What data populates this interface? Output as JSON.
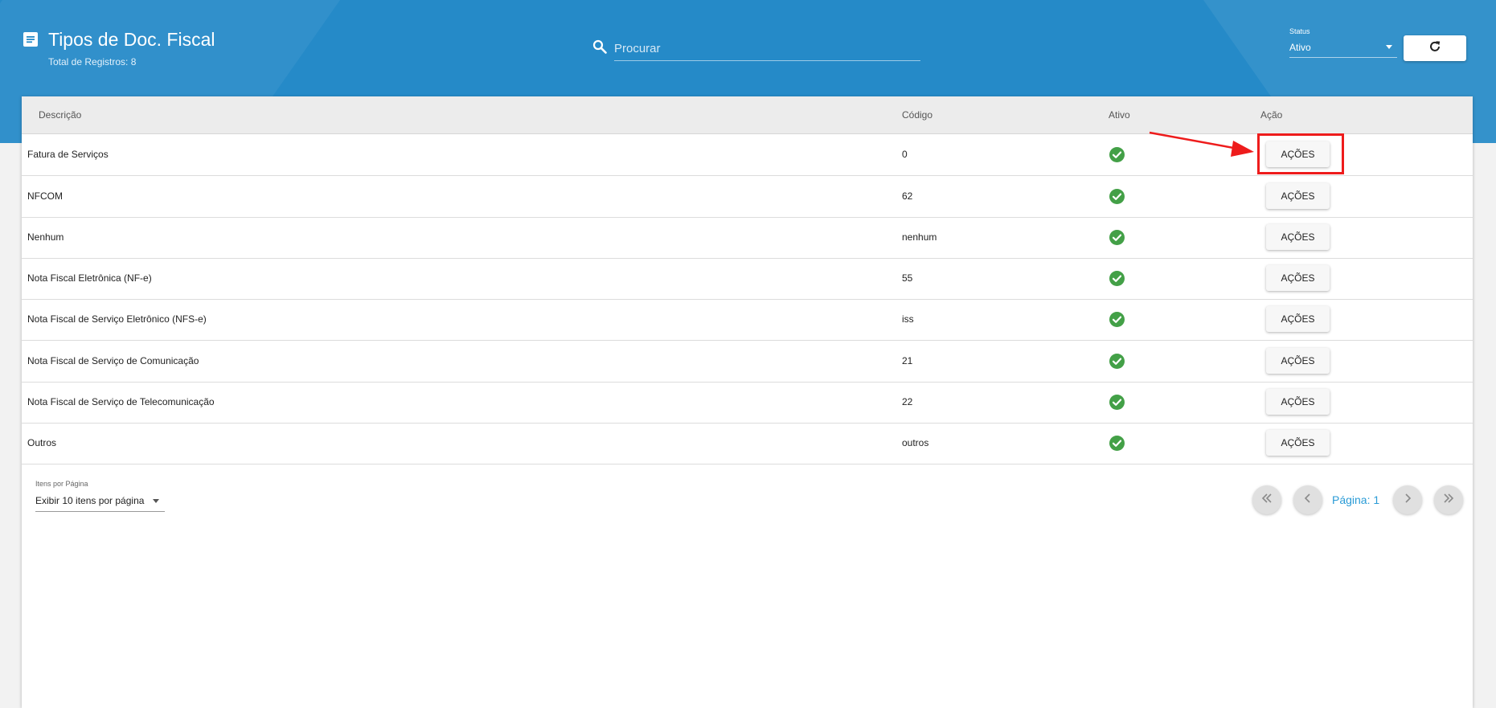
{
  "header": {
    "title": "Tipos de Doc. Fiscal",
    "subtitle": "Total de Registros: 8",
    "search": {
      "placeholder": "Procurar",
      "value": ""
    },
    "status": {
      "label": "Status",
      "value": "Ativo"
    },
    "icons": {
      "title": "document-icon",
      "search": "search-icon",
      "refresh": "refresh-icon"
    },
    "color": "#258ac8"
  },
  "table": {
    "columns": [
      "Descrição",
      "Código",
      "Ativo",
      "Ação"
    ],
    "action_label": "AÇÕES",
    "rows": [
      {
        "descricao": "Fatura de Serviços",
        "codigo": "0",
        "ativo": true
      },
      {
        "descricao": "NFCOM",
        "codigo": "62",
        "ativo": true
      },
      {
        "descricao": "Nenhum",
        "codigo": "nenhum",
        "ativo": true
      },
      {
        "descricao": "Nota Fiscal Eletrônica (NF-e)",
        "codigo": "55",
        "ativo": true
      },
      {
        "descricao": "Nota Fiscal de Serviço Eletrônico (NFS-e)",
        "codigo": "iss",
        "ativo": true
      },
      {
        "descricao": "Nota Fiscal de Serviço de Comunicação",
        "codigo": "21",
        "ativo": true
      },
      {
        "descricao": "Nota Fiscal de Serviço de Telecomunicação",
        "codigo": "22",
        "ativo": true
      },
      {
        "descricao": "Outros",
        "codigo": "outros",
        "ativo": true
      }
    ],
    "active_color": "#43a047"
  },
  "pagination": {
    "per_page_label": "Itens por Página",
    "per_page_value": "Exibir 10 itens por página",
    "page_label": "Página: 1",
    "icons": [
      "first-page-icon",
      "previous-page-icon",
      "next-page-icon",
      "last-page-icon"
    ]
  },
  "annotation": {
    "color": "#ee1c1c"
  }
}
